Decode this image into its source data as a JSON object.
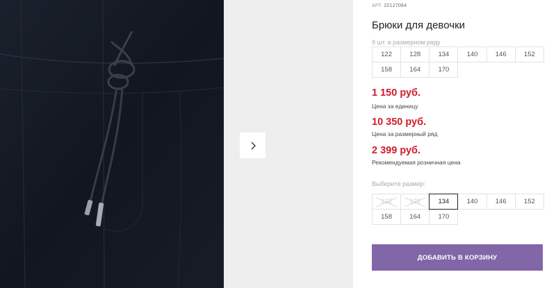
{
  "product": {
    "article_label": "АРТ.",
    "article_number": "22127064",
    "title": "Брюки для девочки",
    "range_label": "9 шт. в размерном ряду",
    "range_sizes": [
      "122",
      "128",
      "134",
      "140",
      "146",
      "152",
      "158",
      "164",
      "170"
    ]
  },
  "prices": [
    {
      "value": "1 150 руб.",
      "note": "Цена за единицу"
    },
    {
      "value": "10 350 руб.",
      "note": "Цена за размерный ряд"
    },
    {
      "value": "2 399 руб.",
      "note": "Рекомендуемая розничная цена"
    }
  ],
  "size_select": {
    "label": "Выберите размер:",
    "options": [
      {
        "size": "122",
        "state": "unavailable"
      },
      {
        "size": "128",
        "state": "unavailable"
      },
      {
        "size": "134",
        "state": "selected"
      },
      {
        "size": "140",
        "state": "available"
      },
      {
        "size": "146",
        "state": "available"
      },
      {
        "size": "152",
        "state": "available"
      },
      {
        "size": "158",
        "state": "available"
      },
      {
        "size": "164",
        "state": "available"
      },
      {
        "size": "170",
        "state": "available"
      }
    ]
  },
  "cart": {
    "button_label": "ДОБАВИТЬ В КОРЗИНУ"
  },
  "gallery": {
    "next_icon": "chevron-right-icon"
  },
  "colors": {
    "price": "#d01c2c",
    "button": "#8166a8",
    "photo_bg": "#141923"
  }
}
